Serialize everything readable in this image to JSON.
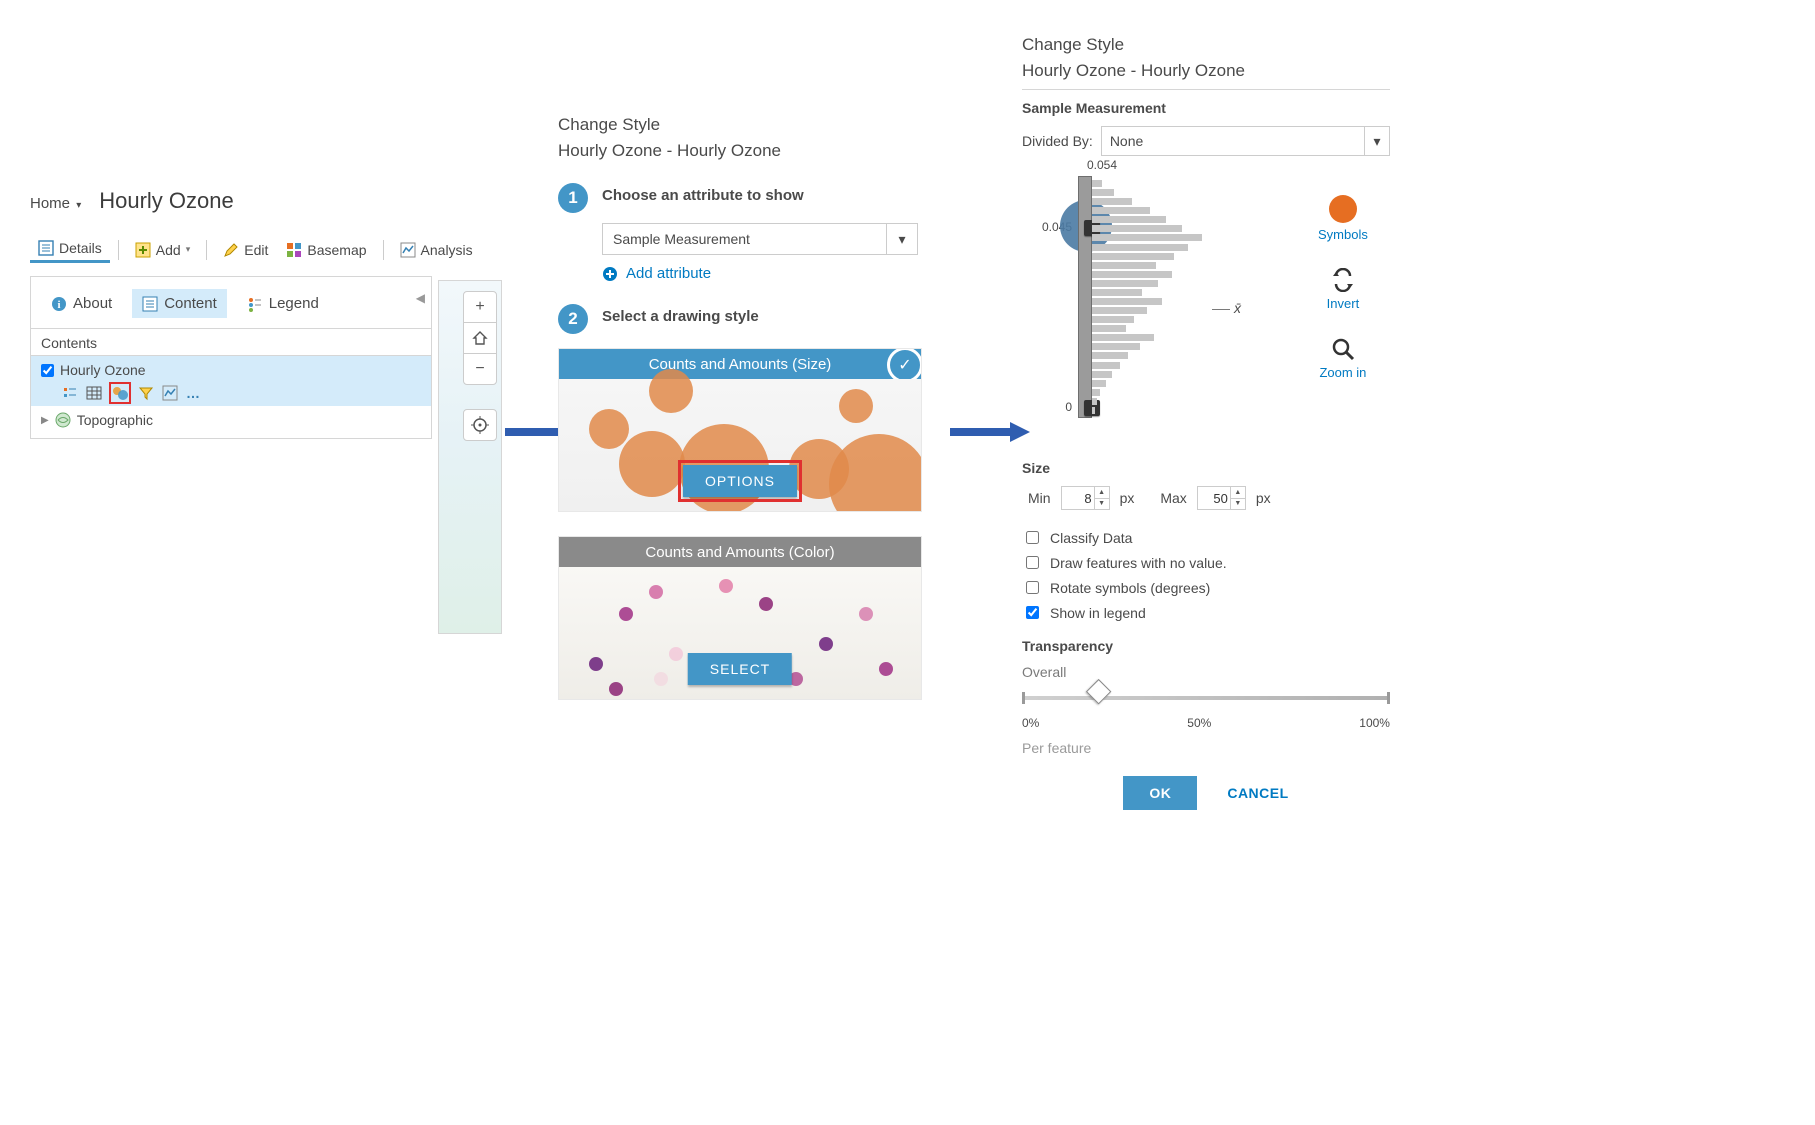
{
  "left": {
    "home_label": "Home",
    "map_title": "Hourly Ozone",
    "toolbar": {
      "details": "Details",
      "add": "Add",
      "edit": "Edit",
      "basemap": "Basemap",
      "analysis": "Analysis"
    },
    "tabs": {
      "about": "About",
      "content": "Content",
      "legend": "Legend"
    },
    "contents_label": "Contents",
    "layer_name": "Hourly Ozone",
    "more_options": "…",
    "basemap_layer": "Topographic"
  },
  "mid": {
    "title": "Change Style",
    "subtitle": "Hourly Ozone - Hourly Ozone",
    "step1_label": "Choose an attribute to show",
    "attribute_value": "Sample Measurement",
    "add_attribute": "Add attribute",
    "step2_label": "Select a drawing style",
    "style_size": "Counts and Amounts (Size)",
    "options_btn": "OPTIONS",
    "style_color": "Counts and Amounts (Color)",
    "select_btn": "SELECT"
  },
  "right": {
    "title": "Change Style",
    "subtitle": "Hourly Ozone - Hourly Ozone",
    "field_label": "Sample Measurement",
    "divided_by_label": "Divided By:",
    "divided_by_value": "None",
    "axis_max": "0.054",
    "axis_break": "0.045",
    "axis_min": "0",
    "bars": [
      10,
      22,
      40,
      58,
      74,
      90,
      110,
      96,
      82,
      64,
      80,
      66,
      50,
      70,
      55,
      42,
      34,
      62,
      48,
      36,
      28,
      20,
      14,
      8,
      5,
      3
    ],
    "xbar_label": "x̄",
    "tools": {
      "symbols": "Symbols",
      "invert": "Invert",
      "zoom_in": "Zoom in"
    },
    "size_label": "Size",
    "size_min_label": "Min",
    "size_min_value": "8",
    "size_max_label": "Max",
    "size_max_value": "50",
    "px_label": "px",
    "checks": {
      "classify": "Classify Data",
      "no_value": "Draw features with no value.",
      "rotate": "Rotate symbols (degrees)",
      "legend": "Show in legend"
    },
    "transparency_label": "Transparency",
    "overall_label": "Overall",
    "t0": "0%",
    "t50": "50%",
    "t100": "100%",
    "per_feature": "Per feature",
    "ok": "OK",
    "cancel": "CANCEL"
  }
}
